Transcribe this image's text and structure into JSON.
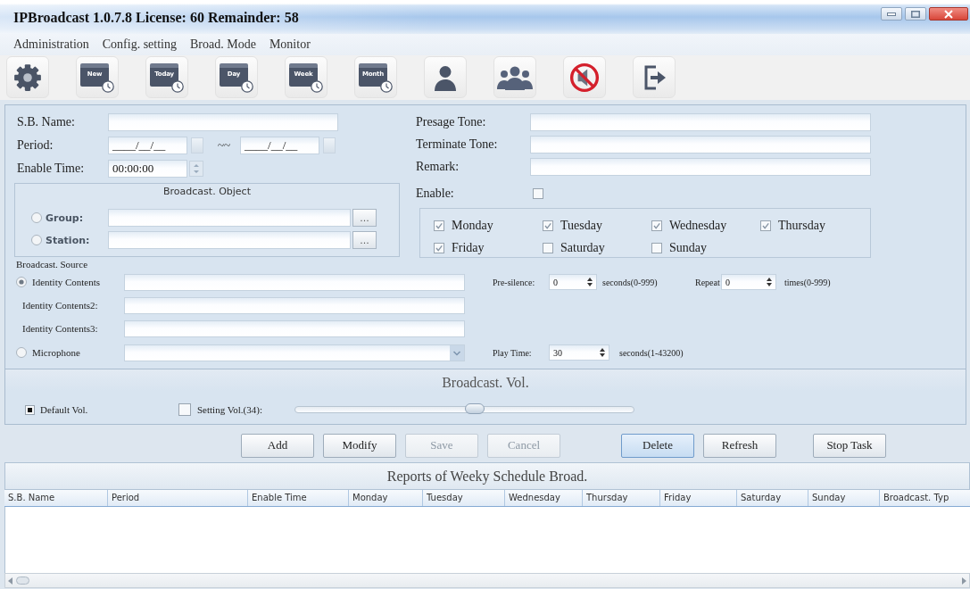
{
  "window": {
    "title": "IPBroadcast 1.0.7.8 License: 60 Remainder: 58"
  },
  "menu": [
    {
      "label": "Administration"
    },
    {
      "label": "Config. setting"
    },
    {
      "label": "Broad. Mode"
    },
    {
      "label": "Monitor"
    }
  ],
  "toolbar": [
    {
      "kind": "gear"
    },
    {
      "kind": "calendar",
      "label": "New"
    },
    {
      "kind": "calendar",
      "label": "Today"
    },
    {
      "kind": "calendar",
      "label": "Day"
    },
    {
      "kind": "calendar",
      "label": "Week"
    },
    {
      "kind": "calendar",
      "label": "Month"
    },
    {
      "kind": "user"
    },
    {
      "kind": "group"
    },
    {
      "kind": "mute"
    },
    {
      "kind": "exit"
    }
  ],
  "schedule": {
    "sb_name": {
      "label": "S.B. Name:"
    },
    "period": {
      "label": "Period:",
      "start": "____/__/__",
      "separator": "~~",
      "end": "____/__/__"
    },
    "enable_time": {
      "label": "Enable Time:",
      "value": "00:00:00"
    },
    "broadcast_object": {
      "title": "Broadcast. Object",
      "options": [
        {
          "label": "Group:",
          "selected": false,
          "browse": "..."
        },
        {
          "label": "Station:",
          "selected": false,
          "browse": "..."
        }
      ]
    },
    "presage_tone": {
      "label": "Presage Tone:"
    },
    "terminate_tone": {
      "label": "Terminate Tone:"
    },
    "remark": {
      "label": "Remark:"
    },
    "enable": {
      "label": "Enable:",
      "checked": false
    },
    "days": [
      {
        "label": "Monday",
        "checked": true
      },
      {
        "label": "Tuesday",
        "checked": true
      },
      {
        "label": "Wednesday",
        "checked": true
      },
      {
        "label": "Thursday",
        "checked": true
      },
      {
        "label": "Friday",
        "checked": true
      },
      {
        "label": "Saturday",
        "checked": false
      },
      {
        "label": "Sunday",
        "checked": false
      }
    ]
  },
  "source": {
    "title": "Broadcast. Source",
    "rows": [
      {
        "kind": "radio_text",
        "label": "Identity Contents",
        "selected": true
      },
      {
        "kind": "text",
        "label": "Identity Contents2:"
      },
      {
        "kind": "text",
        "label": "Identity Contents3:"
      },
      {
        "kind": "radio_combo",
        "label": "Microphone",
        "selected": false
      }
    ],
    "pre_silence": {
      "label": "Pre-silence:",
      "value": "0",
      "unit": "seconds(0-999)"
    },
    "repeat": {
      "label": "Repeat",
      "value": "0",
      "unit": "times(0-999)"
    },
    "play_time": {
      "label": "Play Time:",
      "value": "30",
      "unit": "seconds(1-43200)"
    }
  },
  "volume": {
    "title": "Broadcast. Vol.",
    "default": {
      "label": "Default Vol.",
      "checked": true
    },
    "setting": {
      "label": "Setting Vol.(34):",
      "checked": false
    },
    "slider": {
      "level": 0.53
    }
  },
  "actions": [
    [
      {
        "label": "Add",
        "disabled": false,
        "focused": false
      },
      {
        "label": "Modify",
        "disabled": false,
        "focused": false
      },
      {
        "label": "Save",
        "disabled": true,
        "focused": false
      },
      {
        "label": "Cancel",
        "disabled": true,
        "focused": false
      }
    ],
    [
      {
        "label": "Delete",
        "disabled": false,
        "focused": true
      },
      {
        "label": "Refresh",
        "disabled": false,
        "focused": false
      }
    ],
    [
      {
        "label": "Stop Task",
        "disabled": false,
        "focused": false
      }
    ]
  ],
  "report": {
    "title": "Reports of Weeky Schedule Broad.",
    "columns": [
      "S.B. Name",
      "Period",
      "Enable Time",
      "Monday",
      "Tuesday",
      "Wednesday",
      "Thursday",
      "Friday",
      "Saturday",
      "Sunday",
      "Broadcast. Typ"
    ]
  }
}
